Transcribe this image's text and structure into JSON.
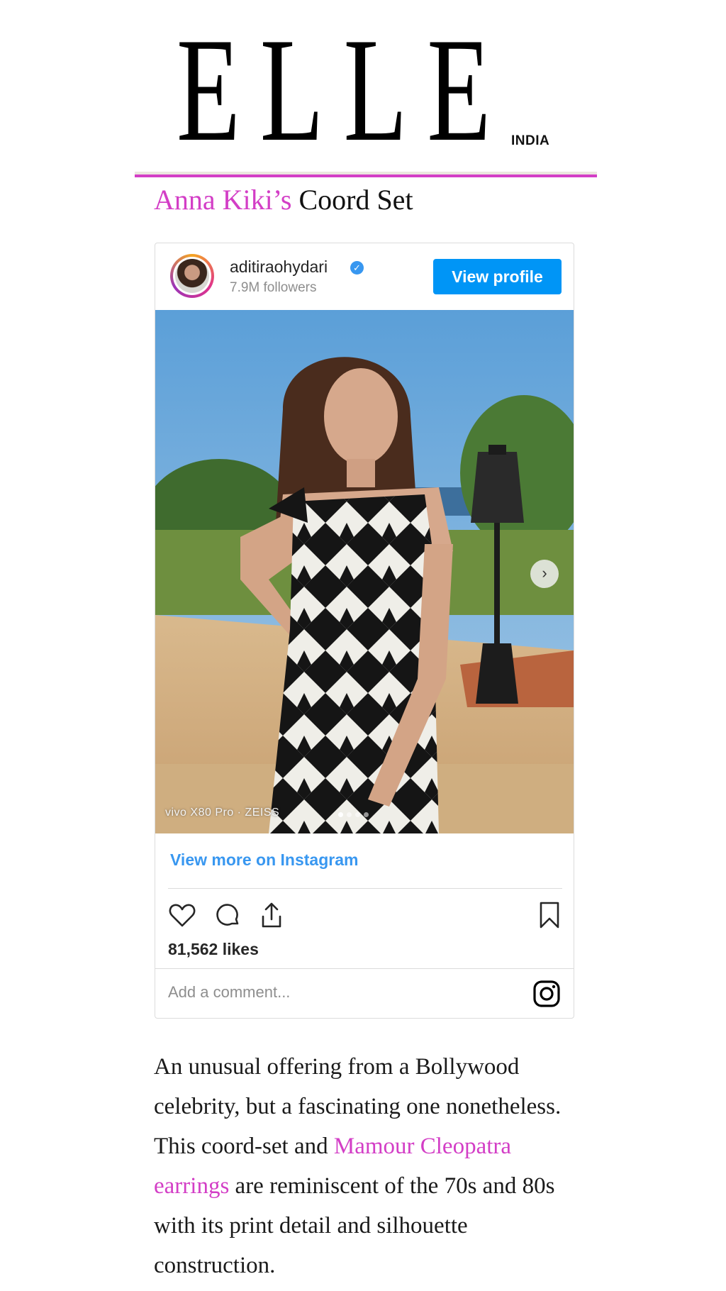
{
  "masthead": {
    "logo": "ELLE",
    "edition": "INDIA"
  },
  "headline": {
    "designer": "Anna Kiki’s",
    "item": " Coord Set"
  },
  "embed": {
    "username": "aditiraohydari",
    "verified_icon": "verified-badge-icon",
    "followers": "7.9M followers",
    "view_profile_label": "View profile",
    "watermark": "vivo X80 Pro · ZEISS",
    "carousel": {
      "total": 4,
      "active": 1
    },
    "view_more_label": "View more on Instagram",
    "likes": "81,562 likes",
    "comment_placeholder": "Add a comment...",
    "icons": [
      "heart-icon",
      "comment-icon",
      "share-icon",
      "bookmark-icon",
      "instagram-icon",
      "chevron-right-icon"
    ]
  },
  "article": {
    "part1": "An unusual offering from a Bollywood celebrity, but a fascinating one nonetheless. This coord-set and ",
    "link": "Mamour Cleopatra earrings",
    "part2": " are reminiscent of the 70s and 80s with its print detail and silhouette construction."
  },
  "colors": {
    "accent_pink": "#d33ec6",
    "instagram_blue": "#0095f6",
    "link_blue": "#3897f0"
  }
}
